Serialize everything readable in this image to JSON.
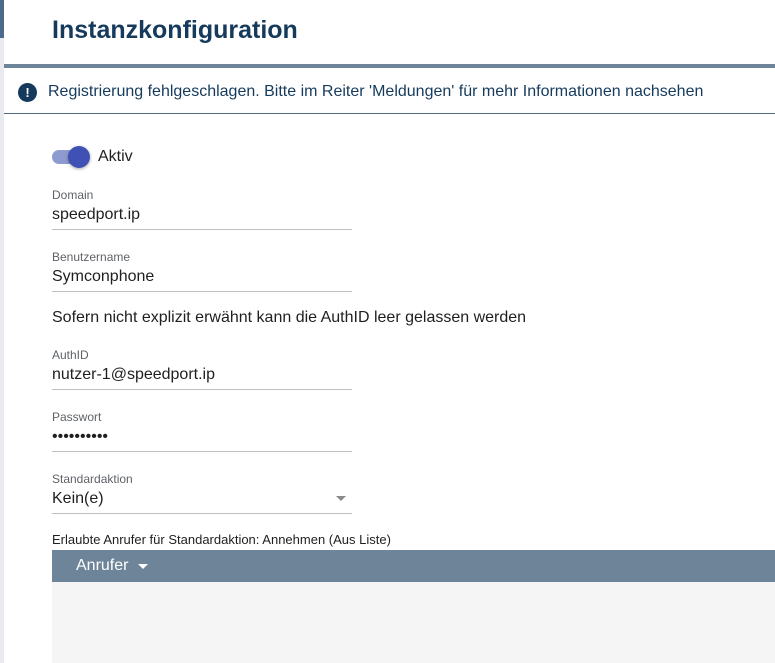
{
  "page": {
    "title": "Instanzkonfiguration"
  },
  "alert": {
    "icon": "exclamation-circle-icon",
    "glyph": "!",
    "message": "Registrierung fehlgeschlagen. Bitte im Reiter 'Meldungen' für mehr Informationen nachsehen"
  },
  "active_toggle": {
    "label": "Aktiv",
    "on": true
  },
  "fields": {
    "domain": {
      "label": "Domain",
      "value": "speedport.ip"
    },
    "username": {
      "label": "Benutzername",
      "value": "Symconphone"
    },
    "authid": {
      "label": "AuthID",
      "value": "nutzer-1@speedport.ip"
    },
    "password": {
      "label": "Passwort",
      "value": "••••••••••"
    },
    "default_action": {
      "label": "Standardaktion",
      "value": "Kein(e)"
    }
  },
  "authid_hint": "Sofern nicht explizit erwähnt kann die AuthID leer gelassen werden",
  "callers_list": {
    "label": "Erlaubte Anrufer für Standardaktion: Annehmen (Aus Liste)",
    "column_header": "Anrufer",
    "rows": []
  },
  "colors": {
    "accent": "#3f51b5",
    "title": "#153a5c",
    "header_bar": "#6e8498"
  }
}
